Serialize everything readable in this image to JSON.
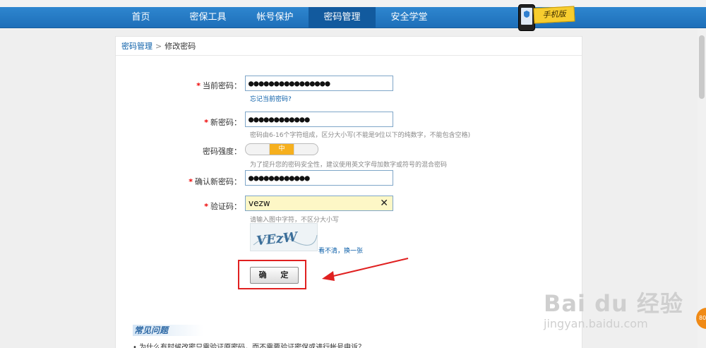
{
  "nav": {
    "items": [
      "首页",
      "密保工具",
      "帐号保护",
      "密码管理",
      "安全学堂"
    ],
    "active": 3,
    "mobile_label": "手机版"
  },
  "breadcrumb": {
    "root": "密码管理",
    "separator": ">",
    "current": "修改密码"
  },
  "form": {
    "current_password": {
      "label": "当前密码：",
      "value": "●●●●●●●●●●●●●●●●",
      "forgot_link": "忘记当前密码?"
    },
    "new_password": {
      "label": "新密码：",
      "value": "●●●●●●●●●●●●",
      "hint": "密码由6-16个字符组成，区分大小写(不能是9位以下的纯数字，不能包含空格)"
    },
    "strength": {
      "label": "密码强度：",
      "level": "中",
      "level_index": 1,
      "hint": "为了提升您的密码安全性，建议使用英文字母加数字或符号的混合密码"
    },
    "confirm_password": {
      "label": "确认新密码：",
      "value": "●●●●●●●●●●●●"
    },
    "captcha": {
      "label": "验证码：",
      "value": "vezw",
      "clear_icon": "close-icon",
      "hint": "请输入图中字符，不区分大小写",
      "image_text": "VEzW",
      "refresh_link": "看不清，换一张"
    },
    "required_mark": "*",
    "submit_label": "确 定"
  },
  "faq": {
    "title": "常见问题",
    "items": [
      "• 为什么有时候改密只需验证原密码，而不需要验证密保或进行帐号申诉？"
    ]
  },
  "watermark": {
    "brand": "Bai du 经验",
    "url": "jingyan.baidu.com"
  },
  "float_badge": "80",
  "colors": {
    "nav_bg": "#1e6fb9",
    "nav_active": "#125a9e",
    "link": "#0a5ea8",
    "required": "#e00000",
    "highlight": "#e02020",
    "captcha_bg": "#fdf7c6",
    "strength_mid": "#f6b01e"
  }
}
